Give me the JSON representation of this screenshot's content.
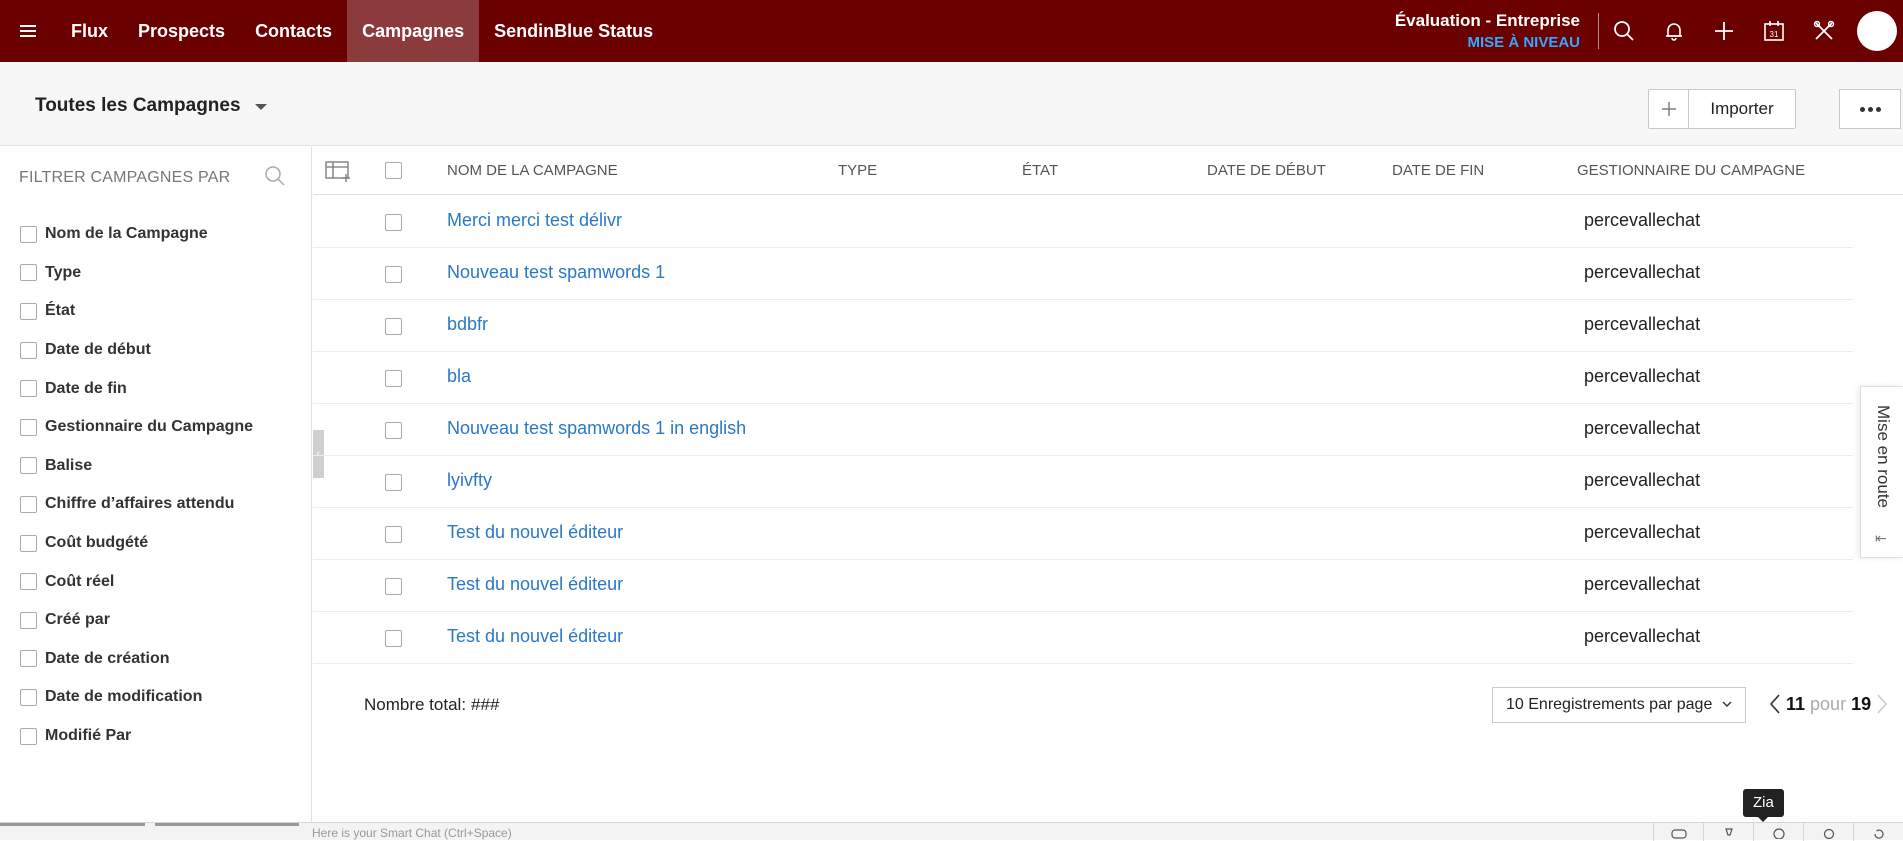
{
  "nav": {
    "tabs": [
      {
        "label": "Flux"
      },
      {
        "label": "Prospects"
      },
      {
        "label": "Contacts"
      },
      {
        "label": "Campagnes"
      },
      {
        "label": "SendinBlue Status"
      }
    ],
    "active_tab": "Campagnes",
    "edition": "Évaluation - Entreprise",
    "upgrade": "MISE À NIVEAU",
    "icons": [
      "search-icon",
      "bell-icon",
      "plus-icon",
      "calendar-icon",
      "tools-icon"
    ],
    "calendar_day": "31"
  },
  "subheader": {
    "view_label": "Toutes les Campagnes",
    "import_label": "Importer"
  },
  "filter": {
    "title": "FILTRER CAMPAGNES PAR",
    "items": [
      {
        "label": "Nom de la Campagne"
      },
      {
        "label": "Type"
      },
      {
        "label": "État"
      },
      {
        "label": "Date de début"
      },
      {
        "label": "Date de fin"
      },
      {
        "label": "Gestionnaire du Campagne"
      },
      {
        "label": "Balise"
      },
      {
        "label": "Chiffre d’affaires attendu"
      },
      {
        "label": "Coût budgété"
      },
      {
        "label": "Coût réel"
      },
      {
        "label": "Créé par"
      },
      {
        "label": "Date de création"
      },
      {
        "label": "Date de modification"
      },
      {
        "label": "Modifié Par"
      }
    ]
  },
  "table": {
    "columns": {
      "name": "NOM DE LA CAMPAGNE",
      "type": "TYPE",
      "state": "ÉTAT",
      "start": "DATE DE DÉBUT",
      "end": "DATE DE FIN",
      "owner": "GESTIONNAIRE DU CAMPAGNE"
    },
    "rows": [
      {
        "name": "Merci merci test délivr",
        "owner": "percevallechat"
      },
      {
        "name": "Nouveau test spamwords 1",
        "owner": "percevallechat"
      },
      {
        "name": "bdbfr",
        "owner": "percevallechat"
      },
      {
        "name": "bla",
        "owner": "percevallechat"
      },
      {
        "name": "Nouveau test spamwords 1 in english",
        "owner": "percevallechat"
      },
      {
        "name": "lyivfty",
        "owner": "percevallechat"
      },
      {
        "name": "Test du nouvel éditeur",
        "owner": "percevallechat"
      },
      {
        "name": "Test du nouvel éditeur",
        "owner": "percevallechat"
      },
      {
        "name": "Test du nouvel éditeur",
        "owner": "percevallechat"
      }
    ]
  },
  "footer": {
    "total_label": "Nombre total:",
    "total_value": "###",
    "per_page": "10 Enregistrements par page",
    "page_from": "11",
    "page_word": "pour",
    "page_to": "19"
  },
  "side_drawer": {
    "label": "Mise en route"
  },
  "bottombar": {
    "chat_placeholder": "Here is your Smart Chat (Ctrl+Space)",
    "tooltip": "Zia"
  },
  "colors": {
    "topbar": "#6b0000",
    "active_tab": "#8b3b3b",
    "link": "#2a78c6",
    "upgrade": "#35a7ff"
  }
}
